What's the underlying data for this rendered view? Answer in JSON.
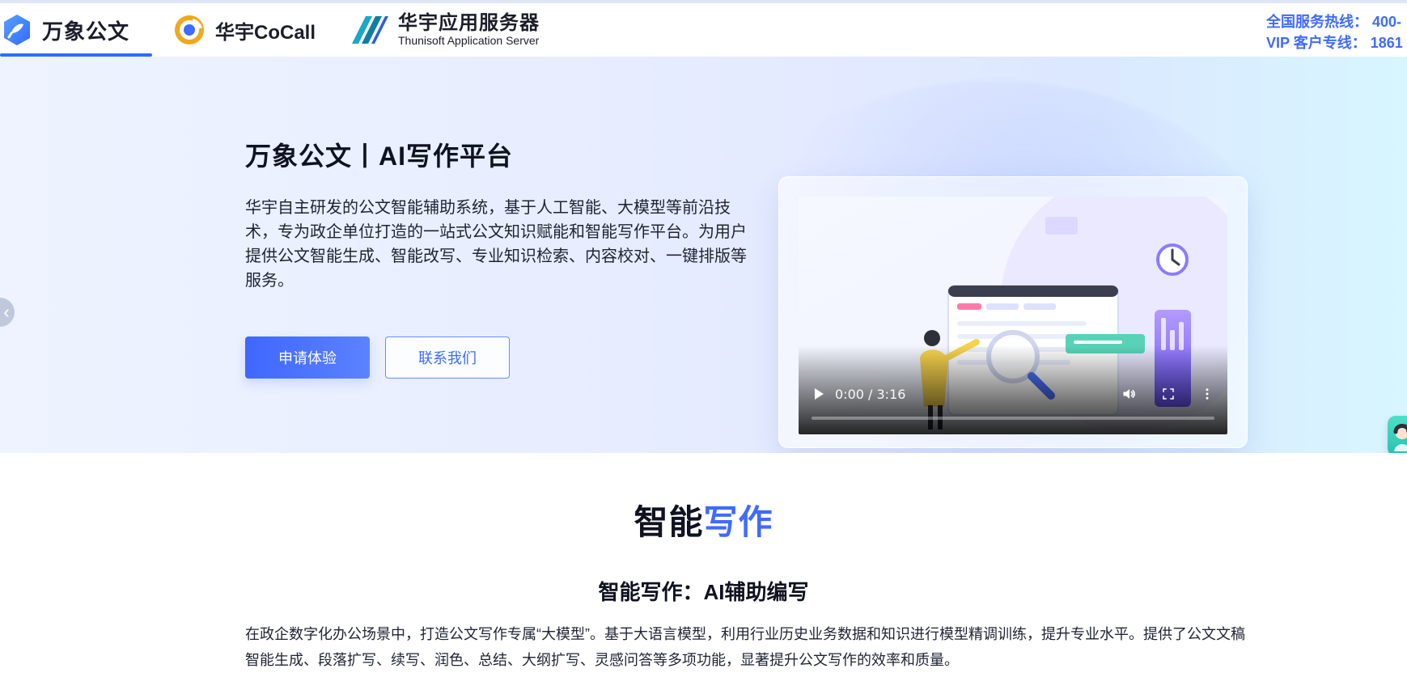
{
  "header": {
    "brands": [
      {
        "label": "万象公文"
      },
      {
        "label": "华宇CoCall"
      },
      {
        "label": "华宇应用服务器",
        "subtitle": "Thunisoft Application Server"
      }
    ],
    "hotline": {
      "line1": "全国服务热线： 400-",
      "line2": "VIP 客户专线： 1861"
    }
  },
  "hero": {
    "title": "万象公文丨AI写作平台",
    "description": "华宇自主研发的公文智能辅助系统，基于人工智能、大模型等前沿技术，专为政企单位打造的一站式公文知识赋能和智能写作平台。为用户提供公文智能生成、智能改写、专业知识检索、内容校对、一键排版等服务。",
    "primary_button": "申请体验",
    "secondary_button": "联系我们",
    "video": {
      "time": "0:00 / 3:16",
      "progress": 0
    },
    "carousel": {
      "prev_glyph": "‹",
      "active_index": 0,
      "count": 2
    }
  },
  "section": {
    "heading_left": "智能",
    "heading_right": "写作",
    "subheading": "智能写作：AI辅助编写",
    "paragraph": "在政企数字化办公场景中，打造公文写作专属“大模型”。基于大语言模型，利用行业历史业务数据和知识进行模型精调训练，提升专业水平。提供了公文文稿智能生成、段落扩写、续写、润色、总结、大纲扩写、灵感问答等多项功能，显著提升公文写作的效率和质量。"
  },
  "colors": {
    "accent": "#3f6bff"
  }
}
